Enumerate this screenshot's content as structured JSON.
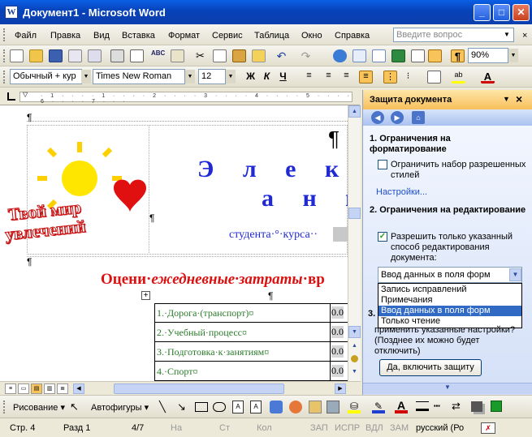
{
  "window": {
    "title": "Документ1 - Microsoft Word",
    "icon": "W"
  },
  "menu": {
    "items": [
      "Файл",
      "Правка",
      "Вид",
      "Вставка",
      "Формат",
      "Сервис",
      "Таблица",
      "Окно",
      "Справка"
    ],
    "ask_placeholder": "Введите вопрос"
  },
  "toolbar": {
    "zoom": "90%"
  },
  "format": {
    "style": "Обычный + кур",
    "font": "Times New Roman",
    "size": "12",
    "bold": "Ж",
    "italic": "К",
    "underline": "Ч"
  },
  "document": {
    "pilcrow": "¶",
    "logo_line1": "Твой мир",
    "logo_line2": "увлечений",
    "big_title_line1": "Э л е к т р о",
    "big_title_line2": "а н к е",
    "student_line": "студента·°·курса··",
    "red_heading_start": "Оцени·",
    "red_heading_italic": "ежедневные·затраты",
    "red_heading_end": "·вр",
    "table_rows": [
      {
        "label": "1.·Дорога·(транспорт)¤",
        "value": "0.0"
      },
      {
        "label": "2.·Учебный·процесс¤",
        "value": "0.0"
      },
      {
        "label": "3.·Подготовка·к·занятиям¤",
        "value": "0.0"
      },
      {
        "label": "4.·Спорт¤",
        "value": "0.0"
      }
    ]
  },
  "pane": {
    "title": "Защита документа",
    "section1_title": "1. Ограничения на форматирование",
    "section1_checkbox": "Ограничить набор разрешенных стилей",
    "settings_link": "Настройки...",
    "section2_title": "2. Ограничения на редактирование",
    "section2_checkbox": "Разрешить только указанный способ редактирования документа:",
    "dropdown_value": "Ввод данных в поля форм",
    "dropdown_options": [
      "Запись исправлений",
      "Примечания",
      "Ввод данных в поля форм",
      "Только чтение"
    ],
    "section3_number": "3.",
    "section3_text_line1": "применить указанные настройки?",
    "section3_text_line2": "(Позднее их можно будет",
    "section3_text_line3": "отключить)",
    "enable_button": "Да, включить защиту"
  },
  "drawing": {
    "draw_label": "Рисование ▾",
    "autoshapes_label": "Автофигуры ▾"
  },
  "status": {
    "page": "Стр. 4",
    "section": "Разд 1",
    "pages": "4/7",
    "at": "На",
    "line": "Ст",
    "col": "Кол",
    "rec": "ЗАП",
    "trk": "ИСПР",
    "ext": "ВДЛ",
    "ovr": "ЗАМ",
    "lang": "русский (Ро"
  }
}
